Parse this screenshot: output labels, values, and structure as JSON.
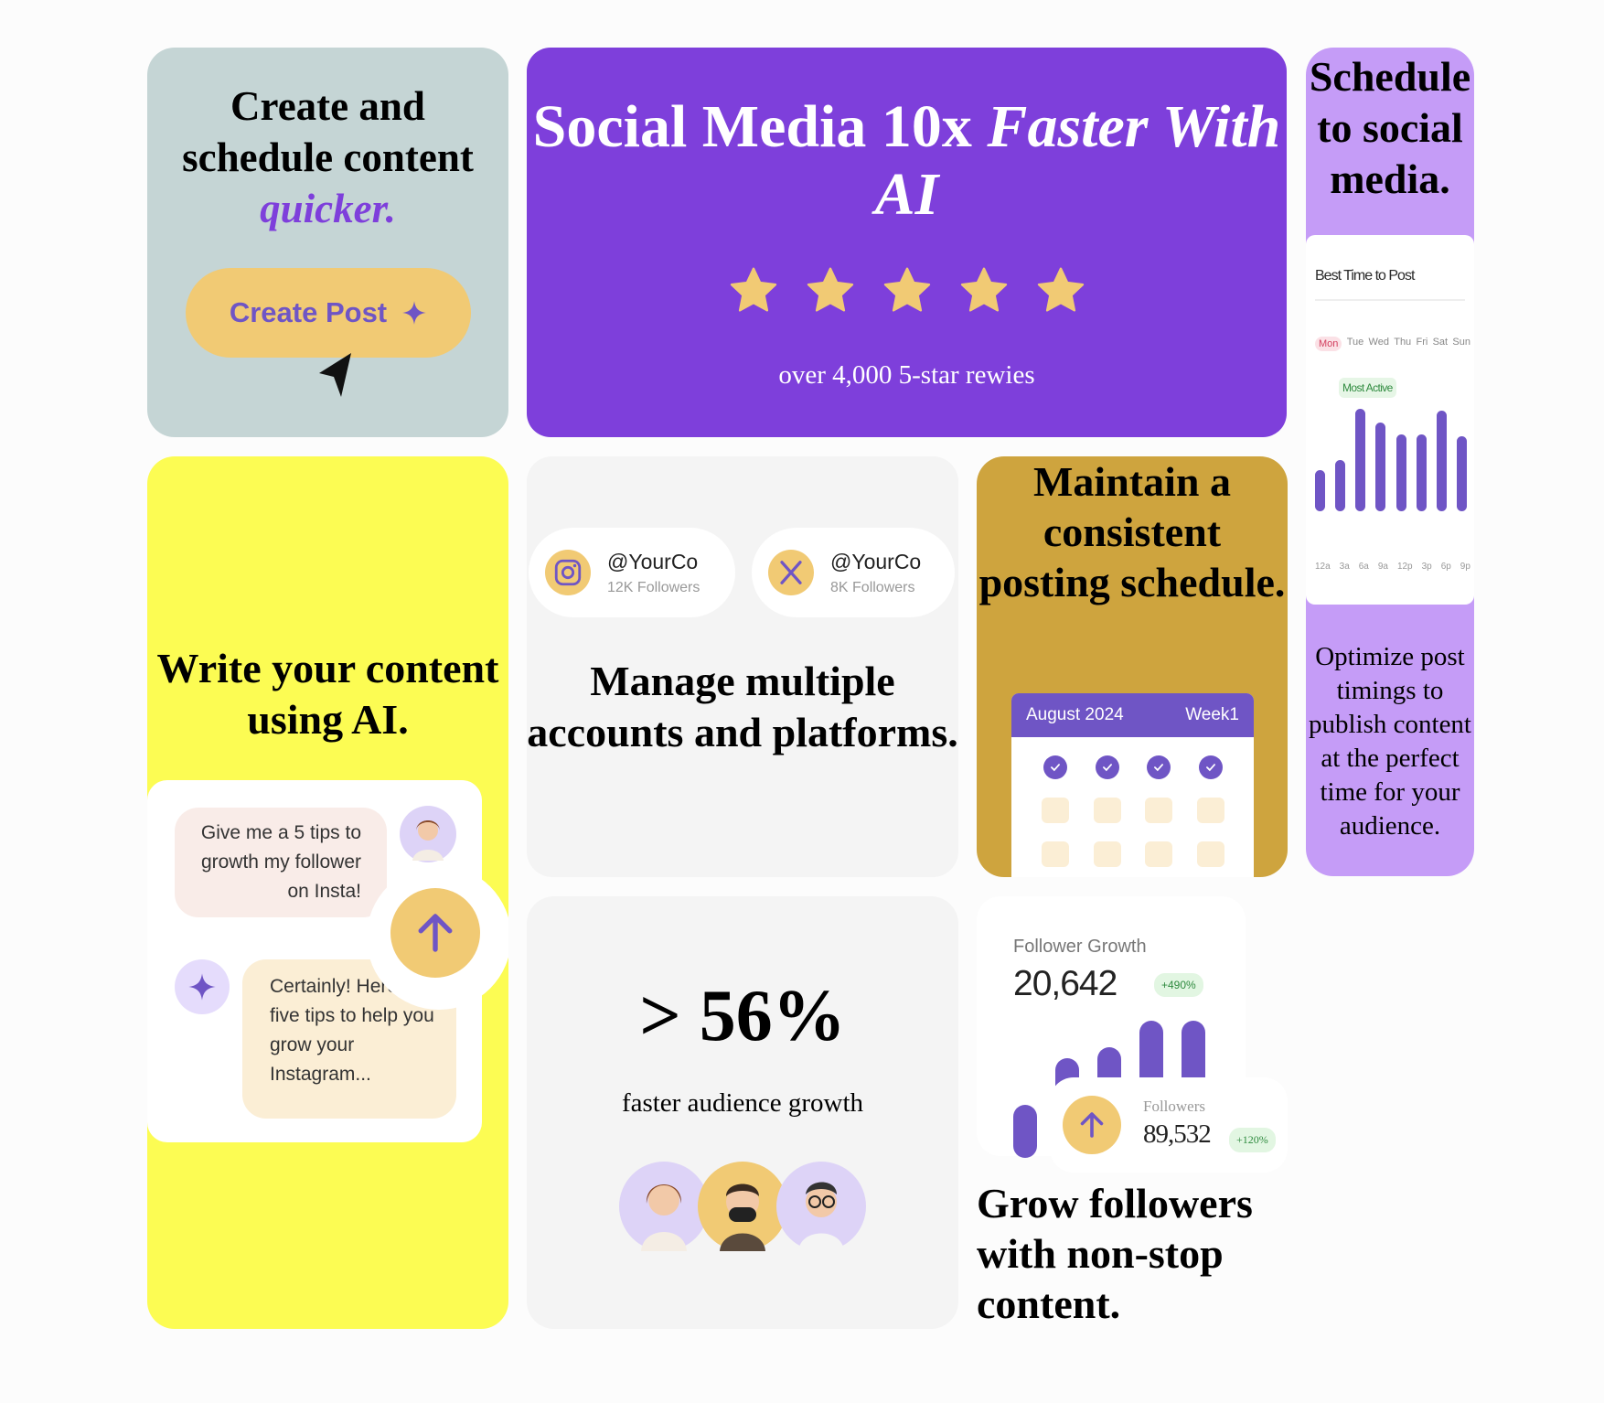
{
  "card_create": {
    "title_line1": "Create and",
    "title_line2": "schedule content",
    "title_accent": "quicker.",
    "button_label": "Create Post"
  },
  "hero": {
    "title_part1": "Social Media 10x ",
    "title_italic": "Faster With AI",
    "rating_stars": 5,
    "subtitle": "over 4,000 5-star rewies"
  },
  "card_schedule": {
    "title": "Schedule to social media.",
    "panel_title": "Best Time to Post",
    "days": [
      "Mon",
      "Tue",
      "Wed",
      "Thu",
      "Fri",
      "Sat",
      "Sun"
    ],
    "selected_day": "Mon",
    "most_active_label": "Most Active",
    "activity_bars": [
      0.4,
      0.5,
      1.0,
      0.87,
      0.75,
      0.75,
      0.98,
      0.73
    ],
    "times": [
      "12a",
      "3a",
      "6a",
      "9a",
      "12p",
      "3p",
      "6p",
      "9p"
    ],
    "description": "Optimize post timings to publish content at the perfect time for your audience."
  },
  "card_ai": {
    "title": "Write your content using AI.",
    "user_message": "Give me a 5 tips to growth my follower on Insta!",
    "ai_message": "Certainly! Here are five tips to help you grow your Instagram..."
  },
  "card_accounts": {
    "accounts": [
      {
        "handle": "@YourCo",
        "followers": "12K Followers",
        "icon": "instagram-icon"
      },
      {
        "handle": "@YourCo",
        "followers": "8K Followers",
        "icon": "x-icon"
      }
    ],
    "title": "Manage multiple accounts and platforms."
  },
  "card_consistent": {
    "title": "Maintain a consistent posting schedule.",
    "calendar_month": "August 2024",
    "calendar_week": "Week1"
  },
  "card_stats": {
    "stat": "> 56%",
    "subtitle": "faster audience growth"
  },
  "card_growth": {
    "panel_label": "Follower Growth",
    "panel_value": "20,642",
    "panel_badge": "+490%",
    "growth_bars": [
      0.52,
      0.62,
      0.72,
      0.98,
      0.98
    ],
    "followers_label": "Followers",
    "followers_value": "89,532",
    "followers_badge": "+120%",
    "title": "Grow followers with non-stop content."
  },
  "colors": {
    "purple": "#7e3fdb",
    "violet": "#6f55c5",
    "gold": "#f1ca74",
    "lavender": "#c59cf7",
    "yellow": "#fcfc53",
    "mustard": "#cea43e",
    "sage": "#c5d5d5"
  }
}
